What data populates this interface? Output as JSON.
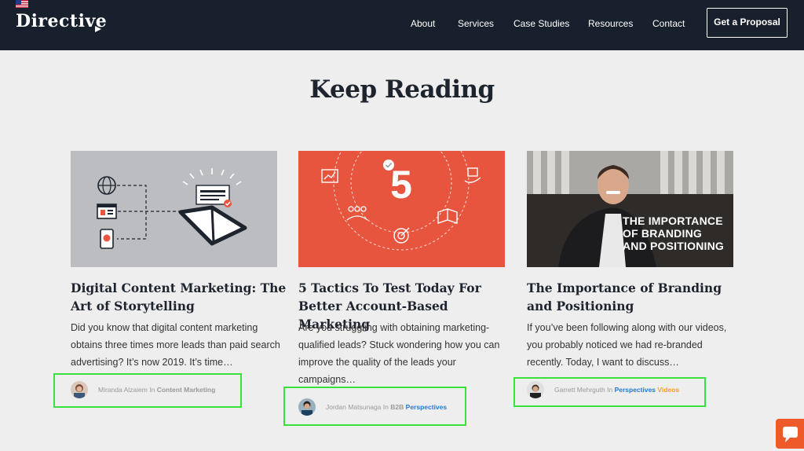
{
  "brand": {
    "logo_text": "Directive",
    "flag_icon": "us-flag-icon",
    "dark_bg": "#18202d"
  },
  "nav": {
    "items": [
      "About",
      "Services",
      "Case Studies",
      "Resources",
      "Contact"
    ],
    "cta_label": "Get a Proposal"
  },
  "section": {
    "title": "Keep Reading"
  },
  "cards": [
    {
      "title": "Digital Content Marketing: The Art of Storytelling",
      "excerpt": "Did you know that digital content marketing obtains three times more leads than paid search advertising? It’s now 2019. It’s time…",
      "author": "Miranda Alzaiem",
      "in_word": "In",
      "category": "Content Marketing",
      "thumb_bg": "#bcbdc0"
    },
    {
      "title": "5 Tactics To Test Today For Better Account-Based Marketing",
      "excerpt": "Are you struggling with obtaining marketing-qualified leads? Stuck wondering how you can improve the quality of the leads your campaigns…",
      "author": "Jordan Matsunaga",
      "in_word": "In",
      "category_prefix": "B2B",
      "category": "Perspectives",
      "thumb_bg": "#e8553e",
      "thumb_number": "5"
    },
    {
      "title": "The Importance of Branding and Positioning",
      "excerpt": "If you’ve been following along with our videos, you probably noticed we had re-branded recently. Today, I want to discuss…",
      "author": "Garrett Mehrguth",
      "in_word": "In",
      "category": "Perspectives",
      "category_2": "Videos",
      "thumb_overlay": [
        "THE IMPORTANCE",
        "OF BRANDING",
        "AND POSITIONING"
      ]
    }
  ],
  "colors": {
    "link_blue": "#1f7bd6",
    "link_orange": "#f0a21b",
    "highlight_green": "#39e23a",
    "chat_orange": "#ef5a2a"
  },
  "chat": {
    "icon": "chat-bubble-icon"
  }
}
